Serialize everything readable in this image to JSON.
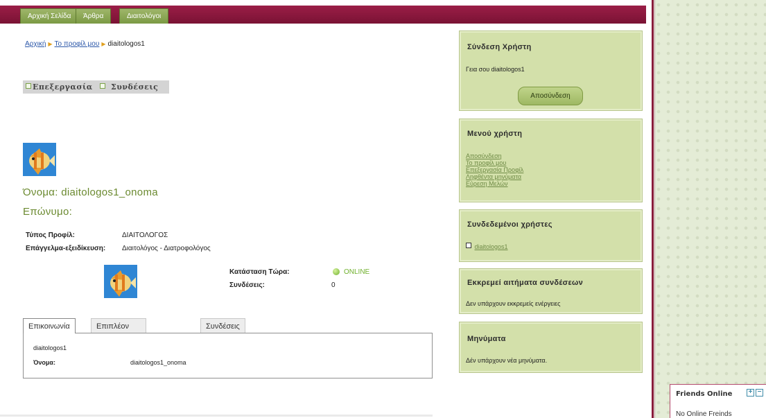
{
  "nav": {
    "tabs": [
      "Αρχική Σελίδα",
      "Άρθρα",
      "Διαιτολόγοι"
    ]
  },
  "breadcrumb": {
    "home": "Αρχική",
    "profile": "Το προφίλ μου",
    "current": "diaitologos1"
  },
  "toolbar": {
    "edit": "Επεξεργασία",
    "connections": "Συνδέσεις"
  },
  "profile": {
    "name_line": "Όνομα: diaitologos1_onoma",
    "surname_line": "Επώνυμο:",
    "type_label": "Τύπος Προφίλ:",
    "type_value": "ΔΙΑΙΤΟΛΟΓΟΣ",
    "prof_label": "Επάγγελμα-εξειδίκευση:",
    "prof_value": "Διαιτολόγος - Διατροφολόγος",
    "status_label": "Κατάσταση Τώρα:",
    "status_value": "ONLINE",
    "connections_label": "Συνδέσεις:",
    "connections_value": "0"
  },
  "profile_tabs": {
    "tabs": [
      "Επικοινωνία",
      "Επιπλέον Πληροφορίες",
      "Συνδέσεις"
    ],
    "panel_username": "diaitologos1",
    "panel_name_label": "Όνομα:",
    "panel_name_value": "diaitologos1_onoma"
  },
  "sidebar": {
    "login": {
      "title": "Σύνδεση Χρήστη",
      "greeting": "Γεια σου diaitologos1",
      "button": "Αποσύνδεση"
    },
    "user_menu": {
      "title": "Μενού χρήστη",
      "links": [
        "Αποσύνδεση",
        "Το προφίλ μου",
        "Επεξεργασία Προφίλ",
        "Ληφθέντα μηνύματα",
        "Εύρεση Μελών"
      ]
    },
    "connected": {
      "title": "Συνδεδεμένοι χρήστες",
      "user": "diaitologos1"
    },
    "pending": {
      "title": "Εκκρεμεί αιτήματα συνδέσεων",
      "text": "Δεν υπάρχουν εκκρεμείς ενέργειες"
    },
    "messages": {
      "title": "Μηνύματα",
      "text": "Δέν υπάρχουν νέα μηνύματα."
    }
  },
  "friends": {
    "title": "Friends Online",
    "status": "No Online Freinds"
  },
  "colors": {
    "nav_bg": "#8a1b3c",
    "tab_green": "#8aa552",
    "sidebar_box": "#d3e0aa",
    "name_green": "#6b8a30"
  }
}
